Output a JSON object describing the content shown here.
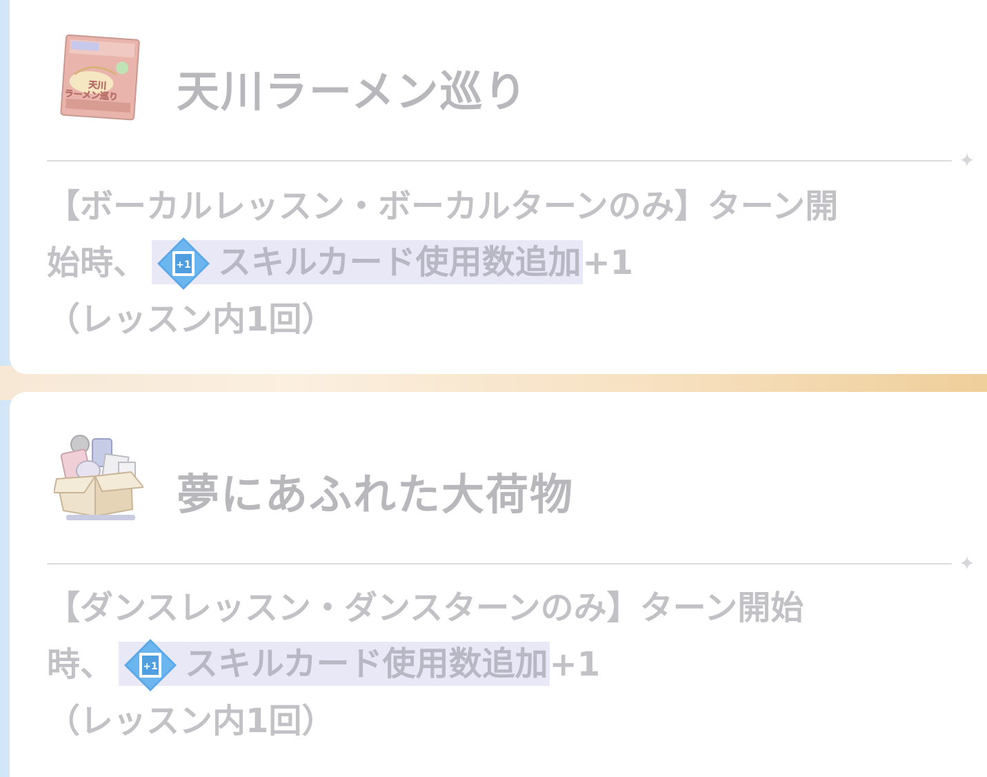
{
  "items": [
    {
      "title": "天川ラーメン巡り",
      "icon": "ramen-package-icon",
      "desc_line1": "【ボーカルレッスン・ボーカルターンのみ】ターン開",
      "desc_line2_prefix": "始時、",
      "keyword": "スキルカード使用数追加",
      "keyword_icon_text": "+1",
      "keyword_suffix": "+1",
      "desc_line3": "（レッスン内1回）"
    },
    {
      "title": "夢にあふれた大荷物",
      "icon": "cardboard-box-icon",
      "desc_line1": "【ダンスレッスン・ダンスターンのみ】ターン開始",
      "desc_line2_prefix": "時、",
      "keyword": "スキルカード使用数追加",
      "keyword_icon_text": "+1",
      "keyword_suffix": "+1",
      "desc_line3": "（レッスン内1回）"
    }
  ],
  "package_label": "天川\nラーメン巡り",
  "colors": {
    "title": "#b8b8bc",
    "desc": "#c2c2c6",
    "keyword_bg": "#e9e8f6",
    "keyword_icon": "#5aa8e8"
  }
}
